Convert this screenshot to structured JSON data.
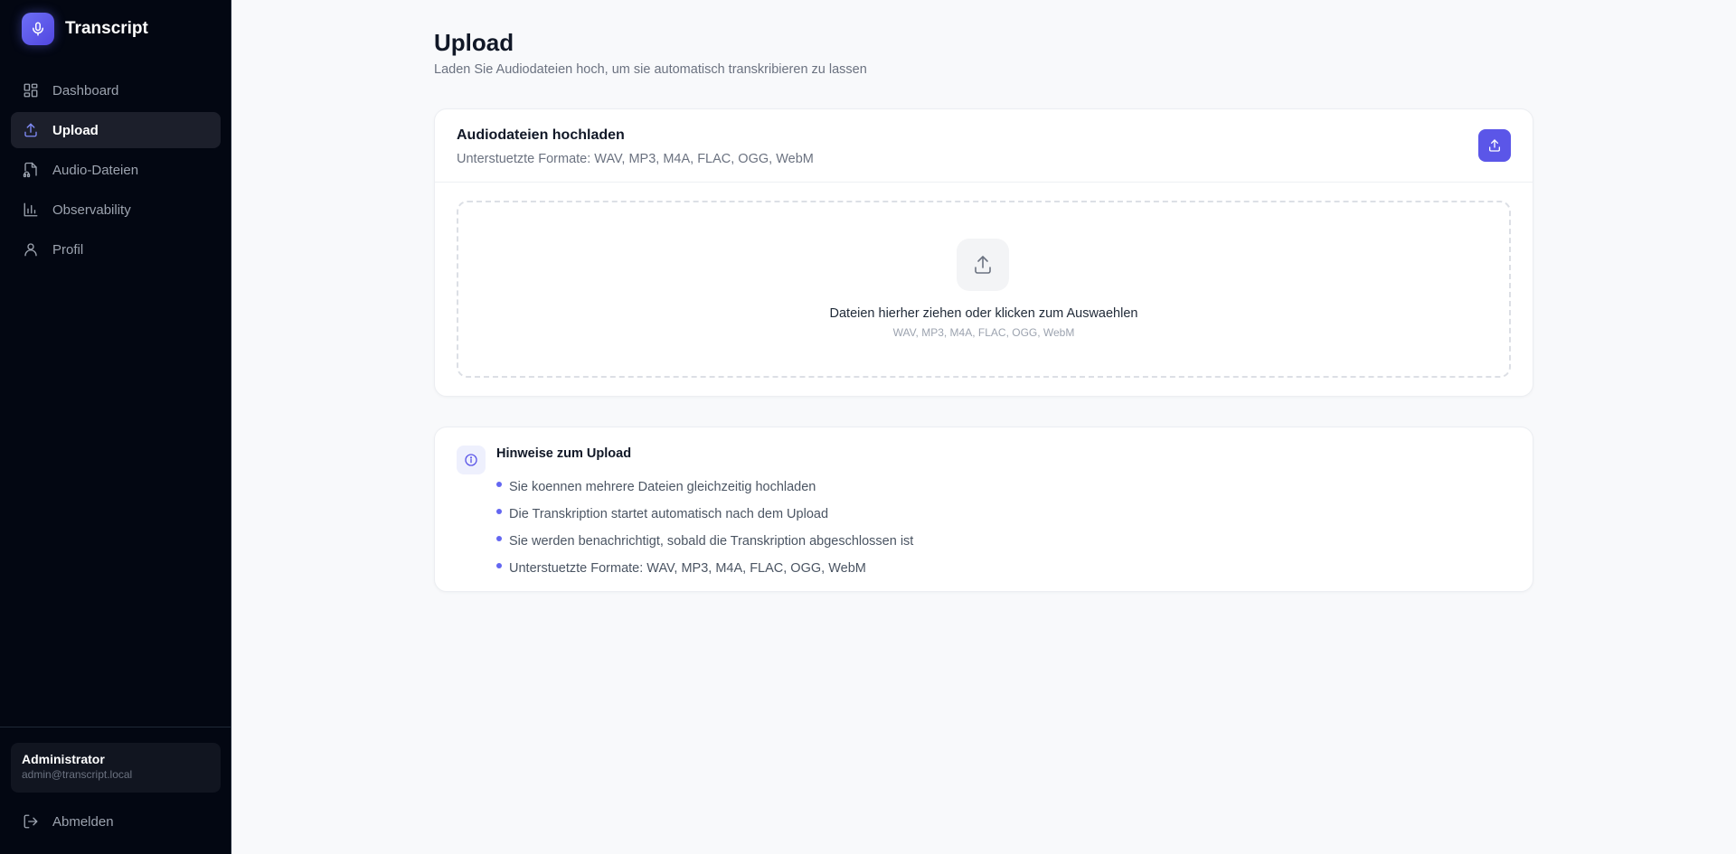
{
  "app": {
    "title": "Transcript"
  },
  "sidebar": {
    "items": [
      {
        "label": "Dashboard",
        "icon": "dashboard-icon"
      },
      {
        "label": "Upload",
        "icon": "upload-icon",
        "active": true
      },
      {
        "label": "Audio-Dateien",
        "icon": "audio-file-icon"
      },
      {
        "label": "Observability",
        "icon": "bar-chart-icon"
      },
      {
        "label": "Profil",
        "icon": "user-icon"
      }
    ],
    "user": {
      "name": "Administrator",
      "email": "admin@transcript.local"
    },
    "logout_label": "Abmelden"
  },
  "page": {
    "title": "Upload",
    "subtitle": "Laden Sie Audiodateien hoch, um sie automatisch transkribieren zu lassen"
  },
  "upload_card": {
    "title": "Audiodateien hochladen",
    "description": "Unterstuetzte Formate: WAV, MP3, M4A, FLAC, OGG, WebM",
    "dropzone_title": "Dateien hierher ziehen oder klicken zum Auswaehlen",
    "dropzone_formats": "WAV, MP3, M4A, FLAC, OGG, WebM"
  },
  "info_card": {
    "title": "Hinweise zum Upload",
    "items": [
      "Sie koennen mehrere Dateien gleichzeitig hochladen",
      "Die Transkription startet automatisch nach dem Upload",
      "Sie werden benachrichtigt, sobald die Transkription abgeschlossen ist",
      "Unterstuetzte Formate: WAV, MP3, M4A, FLAC, OGG, WebM"
    ]
  },
  "colors": {
    "accent": "#5b56e8",
    "sidebar_bg": "#030712",
    "page_bg": "#f8f9fb"
  }
}
